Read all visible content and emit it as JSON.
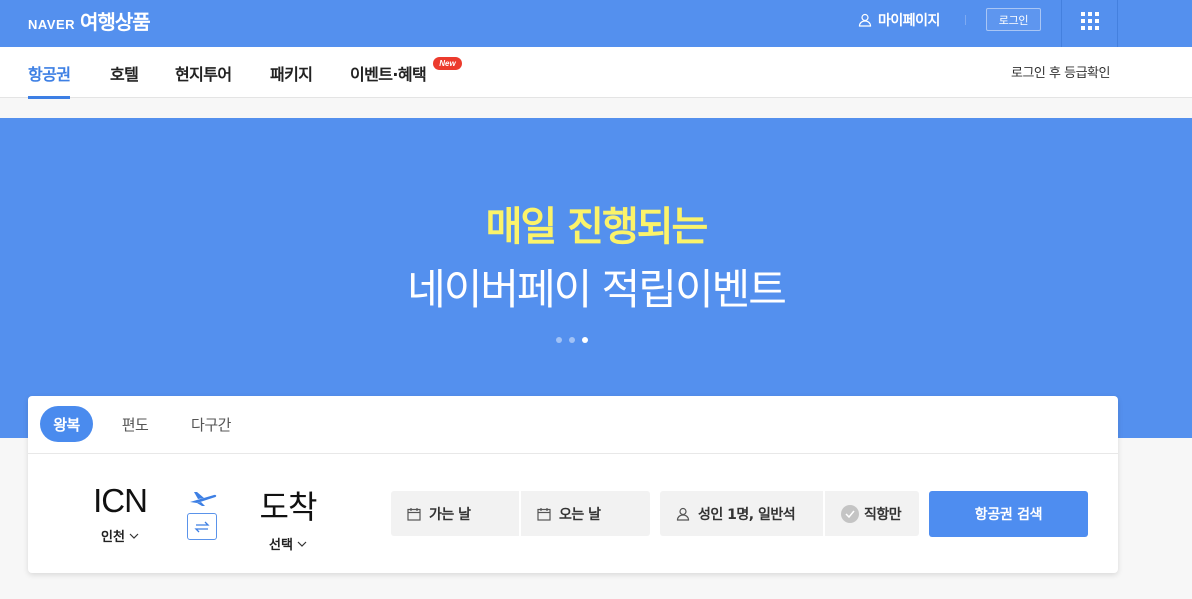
{
  "header": {
    "brand": "NAVER",
    "title": "여행상품",
    "mypage_label": "마이페이지",
    "login_label": "로그인",
    "apps_icon": "grid-icon",
    "color": "#5490ee"
  },
  "nav": {
    "tabs": [
      {
        "label": "항공권",
        "active": true
      },
      {
        "label": "호텔"
      },
      {
        "label": "현지투어"
      },
      {
        "label": "패키지"
      },
      {
        "label": "이벤트·혜택"
      }
    ],
    "new_badge": "New",
    "grade_link": "로그인 후 등급확인",
    "accent": "#3d7fe4"
  },
  "banner": {
    "line1": "매일 진행되는",
    "line2": "네이버페이 적립이벤트",
    "slides": 3,
    "active_slide": 3,
    "headline_color": "#fbf36a"
  },
  "search": {
    "trip_types": [
      "왕복",
      "편도",
      "다구간"
    ],
    "active_trip": "왕복",
    "origin": {
      "code": "ICN",
      "name": "인천"
    },
    "destination": {
      "code": "도착",
      "name": "선택"
    },
    "depart_label": "가는 날",
    "return_label": "오는 날",
    "passengers_label": "성인 1명, 일반석",
    "direct_label": "직항만",
    "search_button": "항공권 검색"
  }
}
